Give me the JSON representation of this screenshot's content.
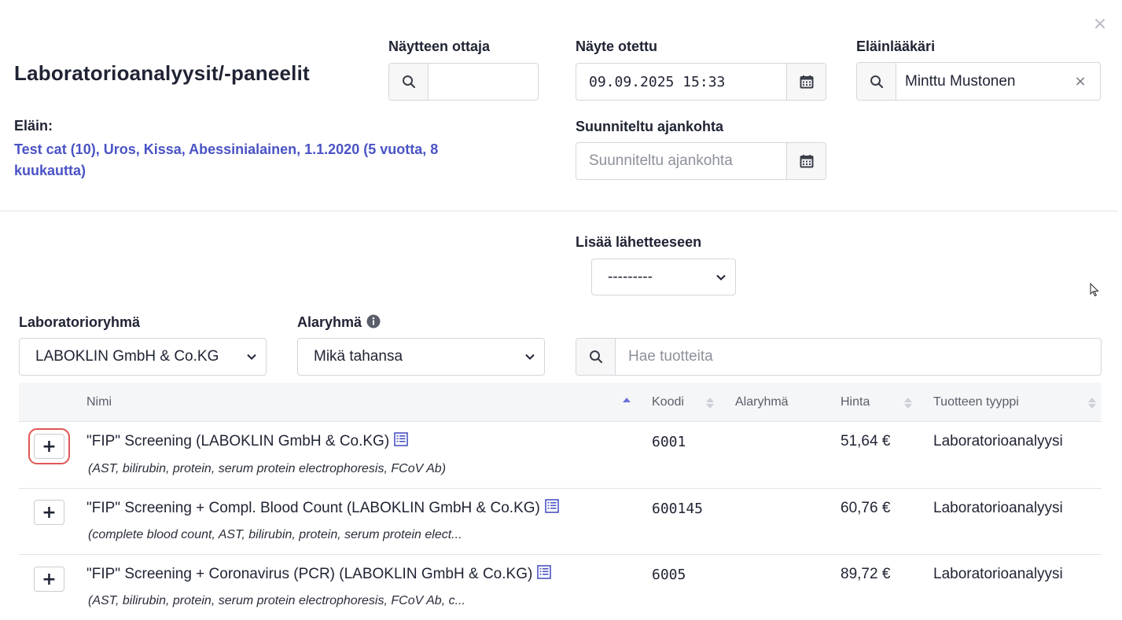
{
  "window": {
    "close_label": "×"
  },
  "header": {
    "title": "Laboratorioanalyysit/-paneelit",
    "animal_label": "Eläin:",
    "animal_value": "Test cat (10), Uros, Kissa, Abessinialainen, 1.1.2020 (5 vuotta, 8 kuukautta)"
  },
  "form": {
    "sampler": {
      "label": "Näytteen ottaja",
      "value": "",
      "placeholder": ""
    },
    "sample_taken": {
      "label": "Näyte otettu",
      "value": "09.09.2025 15:33"
    },
    "planned_time": {
      "label": "Suunniteltu ajankohta",
      "value": "",
      "placeholder": "Suunniteltu ajankohta"
    },
    "veterinarian": {
      "label": "Eläinlääkäri",
      "value": "Minttu Mustonen",
      "clear": "×"
    },
    "add_to_referral": {
      "label": "Lisää lähetteeseen",
      "selected": "---------"
    }
  },
  "filters": {
    "lab_group": {
      "label": "Laboratorioryhmä",
      "selected": "LABOKLIN GmbH & Co.KG"
    },
    "subgroup": {
      "label": "Alaryhmä",
      "selected": "Mikä tahansa"
    },
    "search": {
      "value": "",
      "placeholder": "Hae tuotteita"
    }
  },
  "table": {
    "columns": {
      "name": "Nimi",
      "code": "Koodi",
      "subgroup": "Alaryhmä",
      "price": "Hinta",
      "type": "Tuotteen tyyppi"
    },
    "add_label": "+",
    "rows": [
      {
        "name": "\"FIP\" Screening (LABOKLIN GmbH & Co.KG)",
        "description": "(AST, bilirubin, protein, serum protein electrophoresis, FCoV Ab)",
        "code": "6001",
        "subgroup": "",
        "price": "51,64 €",
        "type": "Laboratorioanalyysi"
      },
      {
        "name": "\"FIP\" Screening + Compl. Blood Count (LABOKLIN GmbH & Co.KG)",
        "description": "(complete blood count, AST, bilirubin, protein, serum protein elect...",
        "code": "600145",
        "subgroup": "",
        "price": "60,76 €",
        "type": "Laboratorioanalyysi"
      },
      {
        "name": "\"FIP\" Screening + Coronavirus (PCR) (LABOKLIN GmbH & Co.KG)",
        "description": "(AST, bilirubin, protein, serum protein electrophoresis, FCoV Ab, c...",
        "code": "6005",
        "subgroup": "",
        "price": "89,72 €",
        "type": "Laboratorioanalyysi"
      }
    ]
  },
  "colors": {
    "accent": "#4a53c4",
    "text": "#1f2333",
    "border": "#d3d6dc",
    "focus": "#e05555"
  }
}
